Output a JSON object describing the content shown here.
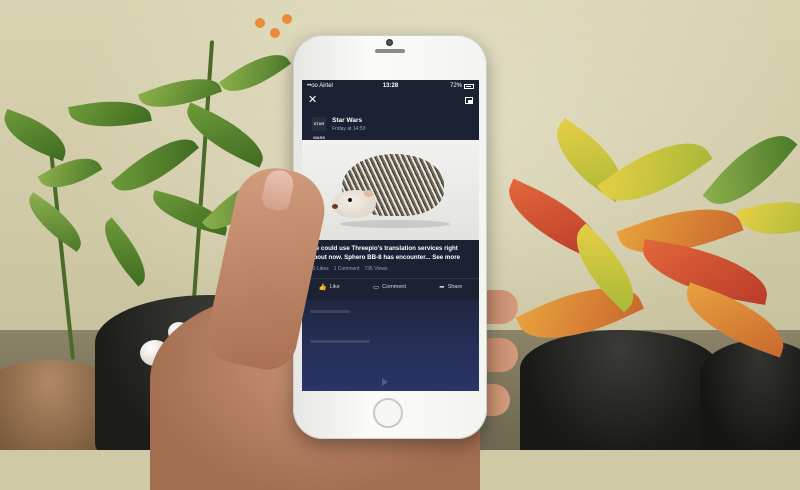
{
  "status_bar": {
    "carrier": "••oo Airtel",
    "time": "13:28",
    "battery": "72%"
  },
  "post": {
    "page_name": "Star Wars",
    "avatar_text": "STAR WARS",
    "timestamp": "Friday at 14:50",
    "caption": "We could use Threepio's translation services right about now. Sphero BB-8 has encounter...",
    "see_more": "See more",
    "likes": "43 Likes",
    "comments": "1 Comment",
    "views": "736 Views"
  },
  "actions": {
    "like": "Like",
    "comment": "Comment",
    "share": "Share"
  },
  "icons": {
    "close": "close-icon",
    "pip": "picture-in-picture-icon",
    "like": "thumbs-up-icon",
    "comment": "comment-icon",
    "share": "share-icon"
  },
  "colors": {
    "screen_bg": "#1c2233",
    "phone_body": "#f3f3f0",
    "subtle_text": "#9aa0b3"
  }
}
